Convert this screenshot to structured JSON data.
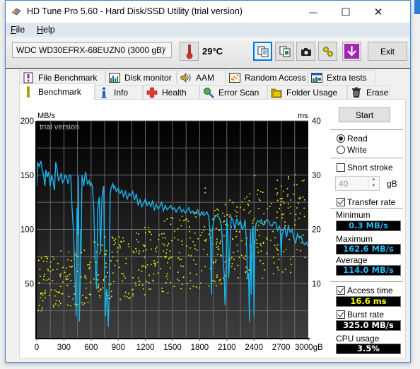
{
  "window": {
    "title": "HD Tune Pro 5.60 - Hard Disk/SSD Utility (trial version)",
    "controls": {
      "minimize": "—",
      "maximize": "☐",
      "close": "✕"
    }
  },
  "menu": [
    {
      "label": "File",
      "accel": "F",
      "rest": "ile"
    },
    {
      "label": "Help",
      "accel": "H",
      "rest": "elp"
    }
  ],
  "toolbar": {
    "drive": "WDC WD30EFRX-68EUZN0 (3000 gB)",
    "temperature": "29°C",
    "buttons": [
      "copy-text",
      "copy-screenshot",
      "save-screenshot",
      "options",
      "download"
    ],
    "exit_label": "Exit"
  },
  "tabs": {
    "row1": [
      {
        "label": "File Benchmark",
        "icon": "file-benchmark-icon"
      },
      {
        "label": "Disk monitor",
        "icon": "disk-monitor-icon"
      },
      {
        "label": "AAM",
        "icon": "speaker-icon"
      },
      {
        "label": "Random Access",
        "icon": "random-access-icon"
      },
      {
        "label": "Extra tests",
        "icon": "extra-tests-icon"
      }
    ],
    "row2": [
      {
        "label": "Benchmark",
        "icon": "exclamation-icon",
        "selected": true
      },
      {
        "label": "Info",
        "icon": "info-icon"
      },
      {
        "label": "Health",
        "icon": "health-cross-icon"
      },
      {
        "label": "Error Scan",
        "icon": "magnifier-icon"
      },
      {
        "label": "Folder Usage",
        "icon": "folder-icon"
      },
      {
        "label": "Erase",
        "icon": "trash-icon"
      }
    ]
  },
  "controls": {
    "start_label": "Start",
    "mode": {
      "options": [
        "Read",
        "Write"
      ],
      "selected": "Read"
    },
    "short_stroke": {
      "label": "Short stroke",
      "checked": false,
      "value": "40",
      "unit": "gB"
    },
    "transfer_rate": {
      "label": "Transfer rate",
      "checked": true
    },
    "minimum": {
      "label": "Minimum",
      "value": "0.3 MB/s"
    },
    "maximum": {
      "label": "Maximum",
      "value": "162.6 MB/s"
    },
    "average": {
      "label": "Average",
      "value": "114.0 MB/s"
    },
    "access_time": {
      "label": "Access time",
      "checked": true,
      "value": "16.6 ms"
    },
    "burst_rate": {
      "label": "Burst rate",
      "checked": true,
      "value": "325.0 MB/s"
    },
    "cpu_usage": {
      "label": "CPU usage",
      "value": "3.5%"
    }
  },
  "colors": {
    "transfer_line": "#1ab4ef",
    "access_dots": "#ffff00",
    "value_cyan": "#2ab6f5",
    "value_yellow": "#ffff00",
    "value_white": "#ffffff",
    "accent": "#0078d7"
  },
  "chart_data": {
    "type": "line",
    "watermark": "trial version",
    "xlabel": "gB",
    "ylabel_left": "MB/s",
    "ylabel_right": "ms",
    "xlim": [
      0,
      3000
    ],
    "ylim_left": [
      0,
      200
    ],
    "ylim_right": [
      0,
      40
    ],
    "x_ticks": [
      "0",
      "300",
      "600",
      "900",
      "1200",
      "1500",
      "1800",
      "2100",
      "2400",
      "2700",
      "3000gB"
    ],
    "y_ticks_left": [
      "50",
      "100",
      "150",
      "200"
    ],
    "y_ticks_right": [
      "10",
      "20",
      "30",
      "40"
    ],
    "grid": true,
    "series": [
      {
        "name": "Transfer rate (MB/s)",
        "axis": "left",
        "x": [
          0,
          10,
          25,
          45,
          60,
          75,
          90,
          100,
          115,
          130,
          150,
          165,
          180,
          195,
          210,
          225,
          240,
          255,
          270,
          285,
          300,
          315,
          330,
          345,
          360,
          375,
          390,
          405,
          420,
          435,
          445,
          455,
          460,
          470,
          480,
          485,
          490,
          500,
          510,
          520,
          525,
          530,
          540,
          550,
          560,
          570,
          580,
          590,
          600,
          615,
          630,
          645,
          660,
          675,
          690,
          705,
          720,
          730,
          740,
          750,
          760,
          770,
          780,
          790,
          800,
          810,
          820,
          830,
          840,
          850,
          860,
          880,
          900,
          920,
          940,
          960,
          980,
          1000,
          1020,
          1040,
          1060,
          1080,
          1100,
          1120,
          1140,
          1160,
          1180,
          1200,
          1220,
          1240,
          1260,
          1280,
          1300,
          1320,
          1340,
          1360,
          1380,
          1400,
          1420,
          1440,
          1460,
          1480,
          1500,
          1520,
          1540,
          1560,
          1580,
          1600,
          1620,
          1640,
          1660,
          1680,
          1700,
          1720,
          1740,
          1760,
          1780,
          1800,
          1820,
          1840,
          1860,
          1880,
          1900,
          1910,
          1920,
          1930,
          1940,
          1960,
          1980,
          2000,
          2020,
          2040,
          2050,
          2060,
          2070,
          2080,
          2090,
          2100,
          2110,
          2120,
          2130,
          2140,
          2150,
          2170,
          2190,
          2210,
          2230,
          2250,
          2270,
          2290,
          2300,
          2310,
          2320,
          2330,
          2340,
          2350,
          2360,
          2370,
          2380,
          2390,
          2400,
          2410,
          2420,
          2440,
          2460,
          2480,
          2500,
          2520,
          2540,
          2560,
          2580,
          2600,
          2620,
          2640,
          2660,
          2680,
          2690,
          2700,
          2710,
          2720,
          2740,
          2760,
          2780,
          2800,
          2820,
          2840,
          2860,
          2880,
          2900,
          2920,
          2940,
          2960,
          2980,
          3000
        ],
        "values": [
          140,
          162,
          158,
          163,
          155,
          150,
          140,
          155,
          148,
          153,
          140,
          150,
          145,
          136,
          162,
          155,
          145,
          147,
          152,
          143,
          145,
          150,
          148,
          142,
          150,
          150,
          120,
          100,
          60,
          20,
          120,
          95,
          150,
          15,
          45,
          100,
          80,
          150,
          145,
          140,
          145,
          148,
          153,
          147,
          142,
          143,
          145,
          140,
          143,
          140,
          120,
          70,
          45,
          120,
          130,
          80,
          130,
          135,
          140,
          55,
          20,
          45,
          40,
          10,
          40,
          130,
          138,
          140,
          142,
          138,
          140,
          135,
          138,
          133,
          136,
          130,
          135,
          128,
          133,
          131,
          135,
          127,
          133,
          122,
          128,
          121,
          124,
          128,
          122,
          125,
          121,
          126,
          118,
          123,
          119,
          121,
          125,
          117,
          122,
          118,
          120,
          122,
          118,
          120,
          116,
          119,
          121,
          116,
          118,
          115,
          117,
          120,
          115,
          117,
          114,
          116,
          118,
          112,
          116,
          113,
          114,
          116,
          112,
          102,
          85,
          40,
          100,
          110,
          113,
          112,
          110,
          103,
          90,
          70,
          60,
          30,
          50,
          110,
          95,
          55,
          70,
          100,
          111,
          108,
          100,
          110,
          104,
          108,
          100,
          103,
          109,
          98,
          80,
          55,
          60,
          15,
          100,
          40,
          98,
          103,
          20,
          90,
          104,
          108,
          107,
          109,
          104,
          106,
          109,
          108,
          104,
          103,
          107,
          106,
          99,
          103,
          100,
          75,
          95,
          97,
          103,
          93,
          103,
          97,
          100,
          92,
          87,
          96,
          92,
          94,
          88,
          86,
          88,
          84,
          85,
          82,
          83,
          85
        ]
      },
      {
        "name": "Access time (ms)",
        "axis": "right",
        "style": "scatter",
        "note": "scattered points between ~4 and ~30 ms, trending upward across the disk; average 16.6 ms"
      }
    ]
  }
}
